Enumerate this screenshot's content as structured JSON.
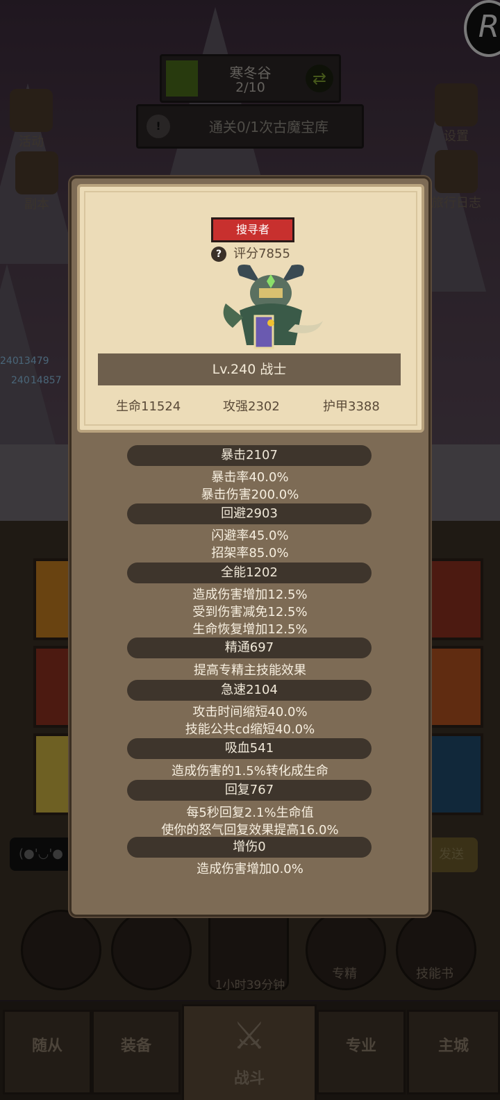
{
  "stage": {
    "name": "寒冬谷",
    "progress": "2/10"
  },
  "quest": {
    "text": "通关0/1次古魔宝库"
  },
  "side_left": [
    "活动",
    "副本"
  ],
  "side_right": [
    "设置",
    "旅行日志"
  ],
  "hud": {
    "level_a": "240",
    "value_a": "13479",
    "level_b": "240",
    "value_b": "14857"
  },
  "chat": {
    "emote": "(●'◡'●",
    "send": "发送"
  },
  "bottom": {
    "timer": "1小时39分钟",
    "specialize": "专精",
    "skillbook": "技能书"
  },
  "nav": {
    "tabs": [
      "随从",
      "装备",
      "战斗",
      "专业",
      "主城"
    ]
  },
  "colors": {
    "modal": "#7d6b55",
    "card": "#ecdcb8",
    "badge": "#c8302e",
    "header": "#3e352c"
  },
  "icons": [
    "help-icon",
    "swap-icon",
    "settings-gear-icon",
    "scroll-icon",
    "portal-icon",
    "journal-icon",
    "potion-icon",
    "bread-icon",
    "chest-icon",
    "book-icon",
    "crossed-swords-icon"
  ],
  "card": {
    "class_badge": "搜寻者",
    "score": "评分7855",
    "level_class": "Lv.240 战士",
    "hp": "生命11524",
    "attack": "攻强2302",
    "armor": "护甲3388"
  },
  "sections": [
    {
      "header": "暴击2107",
      "lines": [
        "暴击率40.0%",
        "暴击伤害200.0%"
      ]
    },
    {
      "header": "回避2903",
      "lines": [
        "闪避率45.0%",
        "招架率85.0%"
      ]
    },
    {
      "header": "全能1202",
      "lines": [
        "造成伤害增加12.5%",
        "受到伤害减免12.5%",
        "生命恢复增加12.5%"
      ]
    },
    {
      "header": "精通697",
      "lines": [
        "提高专精主技能效果"
      ]
    },
    {
      "header": "急速2104",
      "lines": [
        "攻击时间缩短40.0%",
        "技能公共cd缩短40.0%"
      ]
    },
    {
      "header": "吸血541",
      "lines": [
        "造成伤害的1.5%转化成生命"
      ]
    },
    {
      "header": "回复767",
      "lines": [
        "每5秒回复2.1%生命值",
        "使你的怒气回复效果提高16.0%"
      ]
    },
    {
      "header": "增伤0",
      "lines": [
        "造成伤害增加0.0%"
      ]
    }
  ]
}
